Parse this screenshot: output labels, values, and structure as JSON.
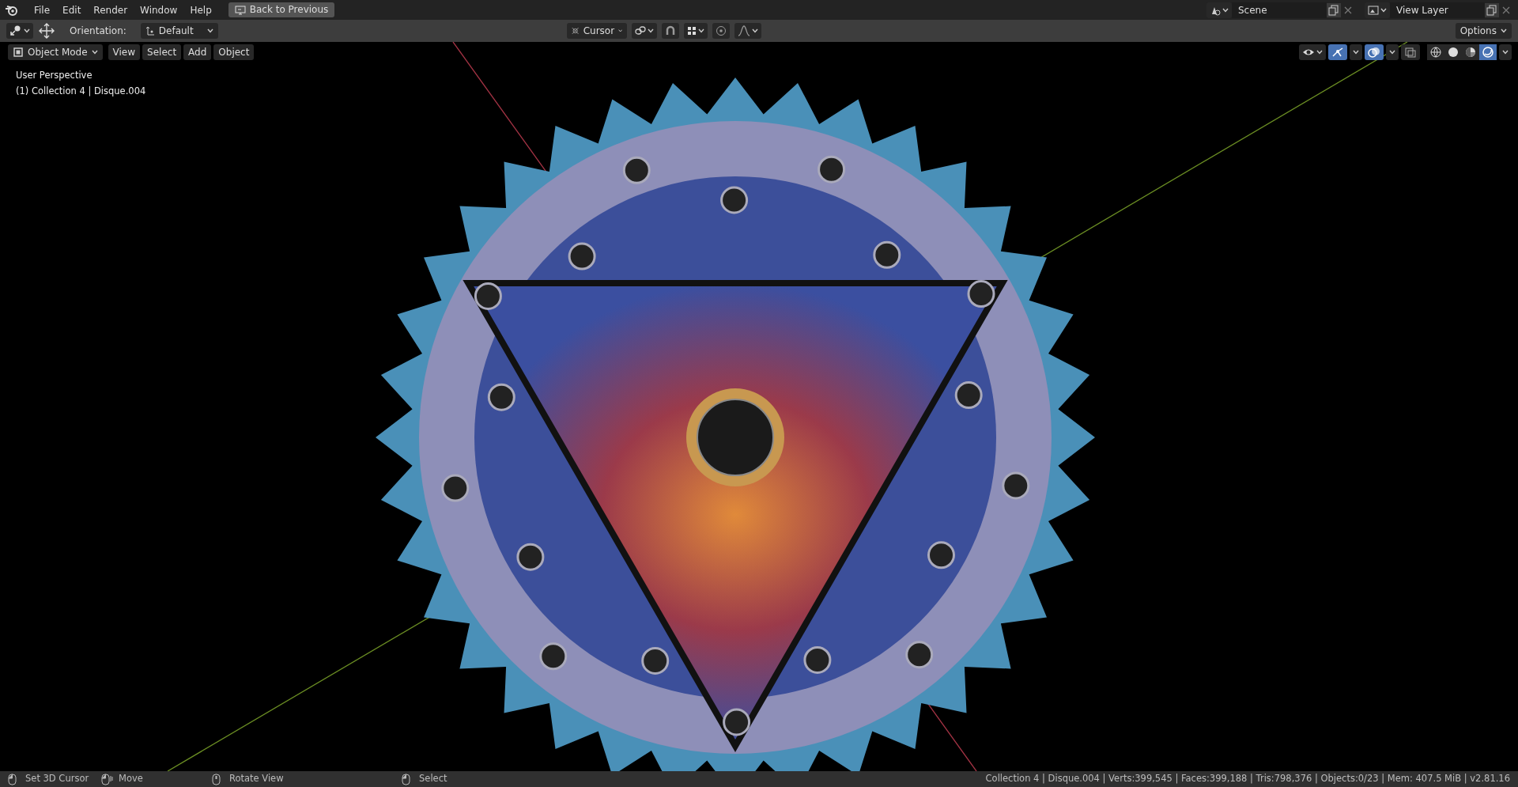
{
  "top_bar": {
    "menus": [
      "File",
      "Edit",
      "Render",
      "Window",
      "Help"
    ],
    "back_button": "Back to Previous",
    "scene": "Scene",
    "view_layer": "View Layer"
  },
  "tool_header": {
    "orientation_label": "Orientation:",
    "orientation": "Default",
    "pivot": "Cursor",
    "options": "Options",
    "snap_on": false,
    "proportional_on": false
  },
  "viewport_header": {
    "mode": "Object Mode",
    "menus": [
      "View",
      "Select",
      "Add",
      "Object"
    ],
    "gizmo_on": true,
    "overlays_on": true,
    "xray_on": false,
    "shading_modes": [
      {
        "kind": "wireframe",
        "selected": false
      },
      {
        "kind": "solid",
        "selected": false
      },
      {
        "kind": "material",
        "selected": false
      },
      {
        "kind": "rendered",
        "selected": true
      }
    ]
  },
  "viewport": {
    "view_name": "User Perspective",
    "object_info": "(1) Collection 4 | Disque.004"
  },
  "status_bar": {
    "hints": [
      {
        "kind": "left",
        "text": "Set 3D Cursor"
      },
      {
        "kind": "drag",
        "text": "Move"
      },
      {
        "kind": "middle",
        "text": "Rotate View"
      },
      {
        "kind": "left",
        "text": "Select"
      }
    ],
    "stats": "Collection 4 | Disque.004 | Verts:399,545 | Faces:399,188 | Tris:798,376 | Objects:0/23 | Mem: 407.5 MiB | v2.81.16"
  }
}
